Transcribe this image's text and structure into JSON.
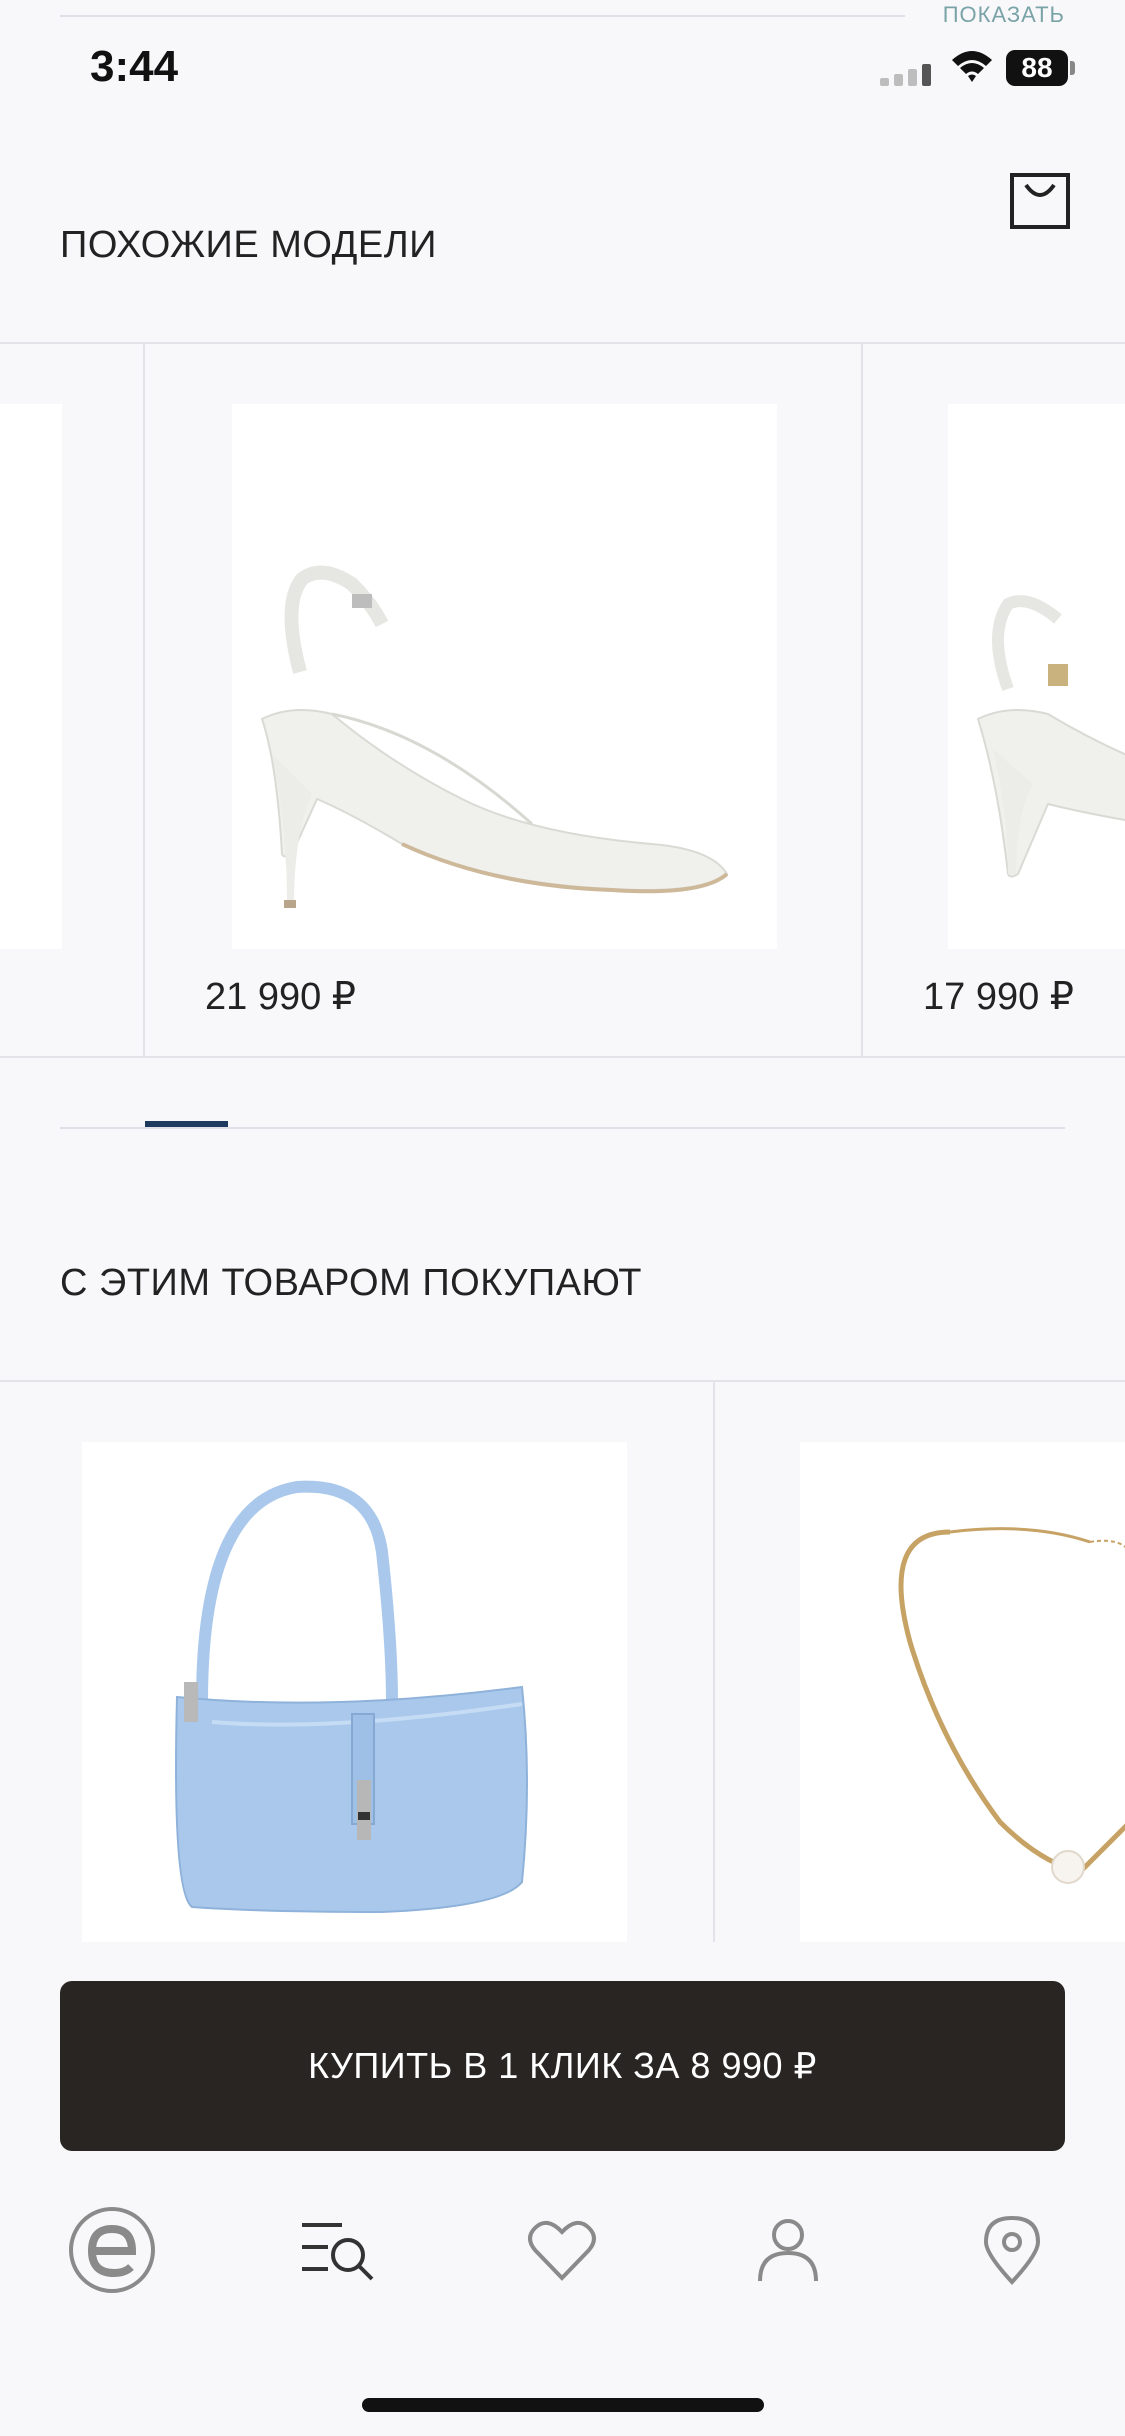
{
  "peek": {
    "show_label": "ПОКАЗАТЬ"
  },
  "status": {
    "time": "3:44",
    "battery": "88"
  },
  "similar": {
    "title": "ПОХОЖИЕ МОДЕЛИ",
    "items": [
      {
        "price": ""
      },
      {
        "price": "21 990 ₽"
      },
      {
        "price": "17 990 ₽"
      }
    ]
  },
  "bought_with": {
    "title": "С ЭТИМ ТОВАРОМ ПОКУПАЮТ"
  },
  "buy_button": {
    "label": "КУПИТЬ В 1 КЛИК ЗА 8 990 ₽"
  },
  "colors": {
    "accent": "#1e3a5f",
    "button_bg": "#282523",
    "bag": "#a9c8ec"
  },
  "tabbar": {
    "items": [
      {
        "icon": "brand-logo-icon"
      },
      {
        "icon": "catalog-search-icon"
      },
      {
        "icon": "heart-icon"
      },
      {
        "icon": "profile-icon"
      },
      {
        "icon": "location-pin-icon"
      }
    ]
  }
}
